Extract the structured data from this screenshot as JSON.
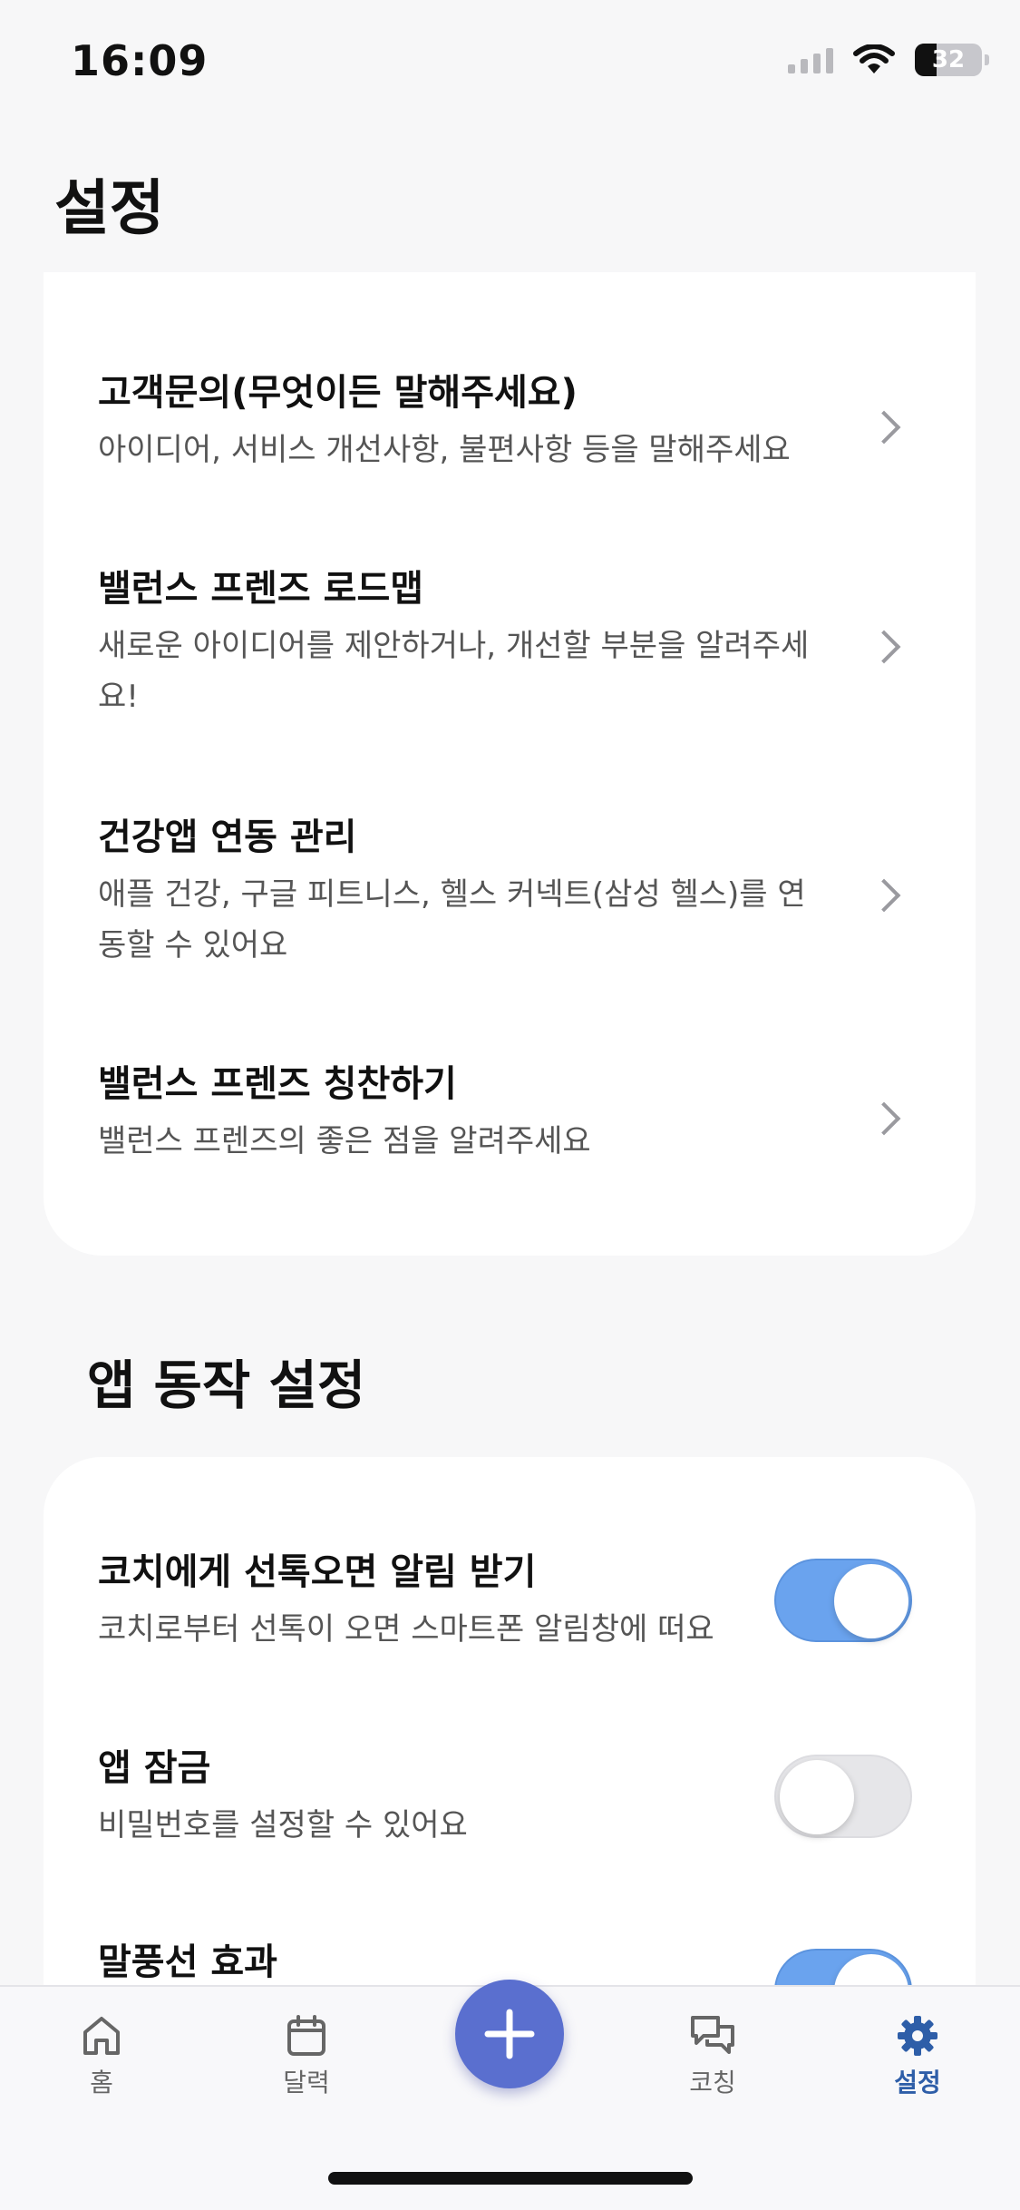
{
  "status_bar": {
    "time": "16:09",
    "battery": "32",
    "icons": [
      "signal-icon",
      "wifi-icon",
      "battery-icon"
    ]
  },
  "page_title": "설정",
  "support_section": {
    "items": [
      {
        "title": "고객문의(무엇이든 말해주세요)",
        "desc": "아이디어, 서비스 개선사항, 불편사항 등을 말해주세요"
      },
      {
        "title": "밸런스 프렌즈 로드맵",
        "desc": "새로운 아이디어를 제안하거나, 개선할 부분을 알려주세요!"
      },
      {
        "title": "건강앱 연동 관리",
        "desc": "애플 건강, 구글 피트니스, 헬스 커넥트(삼성 헬스)를 연동할 수 있어요"
      },
      {
        "title": "밸런스 프렌즈 칭찬하기",
        "desc": "밸런스 프렌즈의 좋은 점을 알려주세요"
      }
    ]
  },
  "app_settings": {
    "title": "앱 동작 설정",
    "items": [
      {
        "title": "코치에게 선톡오면 알림 받기",
        "desc": "코치로부터 선톡이 오면 스마트폰 알림창에 떠요",
        "enabled": true
      },
      {
        "title": "앱 잠금",
        "desc": "비밀번호를 설정할 수 있어요",
        "enabled": false
      },
      {
        "title": "말풍선 효과",
        "desc": "",
        "enabled": true
      }
    ]
  },
  "tab_bar": {
    "tabs": [
      {
        "label": "홈",
        "icon": "home-icon"
      },
      {
        "label": "달력",
        "icon": "calendar-icon"
      },
      {
        "label": "코칭",
        "icon": "chat-icon"
      },
      {
        "label": "설정",
        "icon": "gear-icon",
        "active": true
      }
    ],
    "fab_icon": "plus-icon"
  },
  "colors": {
    "accent": "#5a6fcf",
    "toggle_on": "#6aa3ee",
    "active_tab": "#2e5ea8"
  }
}
